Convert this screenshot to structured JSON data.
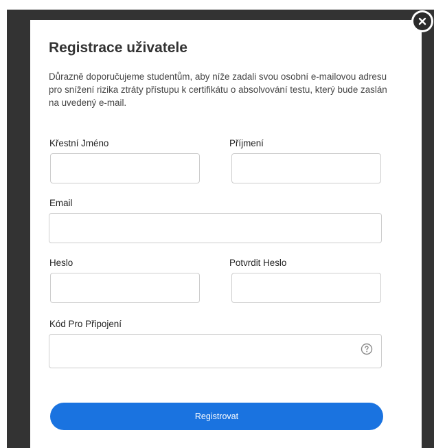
{
  "modal": {
    "title": "Registrace uživatele",
    "intro": "Důrazně doporučujeme studentům, aby níže zadali svou osobní e-mailovou adresu pro snížení rizika ztráty přístupu k certifikátu o absolvování testu, který bude zaslán na uvedený e-mail.",
    "close_icon": "close-icon"
  },
  "form": {
    "first_name_label": "Křestní Jméno",
    "first_name_value": "",
    "last_name_label": "Příjmení",
    "last_name_value": "",
    "email_label": "Email",
    "email_value": "",
    "password_label": "Heslo",
    "password_value": "",
    "confirm_password_label": "Potvrdit Heslo",
    "confirm_password_value": "",
    "code_label": "Kód Pro Připojení",
    "code_value": "",
    "help_icon": "question-circle-icon",
    "submit_label": "Registrovat"
  },
  "colors": {
    "backdrop": "#333333",
    "primary_button": "#1a73e0"
  }
}
